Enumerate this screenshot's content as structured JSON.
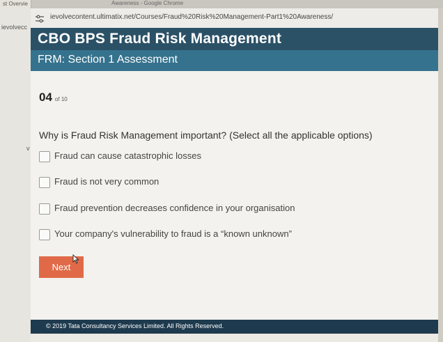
{
  "background": {
    "tab_text": "st Overvie",
    "window_title": "Awareness - Google Chrome",
    "url_fragment": "ievolvecc",
    "stray_char": "v"
  },
  "browser": {
    "url": "ievolvecontent.ultimatix.net/Courses/Fraud%20Risk%20Management-Part1%20Awareness/",
    "site_icon": "site-settings-icon"
  },
  "header": {
    "title": "CBO BPS Fraud Risk Management",
    "subtitle": "FRM: Section 1 Assessment",
    "color_primary": "#2b5166",
    "color_secondary": "#35728d"
  },
  "quiz": {
    "current": "04",
    "total_label": "of 10",
    "question": "Why is Fraud Risk Management important? (Select all the applicable options)",
    "options": [
      {
        "label": "Fraud can cause catastrophic losses",
        "checked": false
      },
      {
        "label": "Fraud is not very common",
        "checked": false
      },
      {
        "label": "Fraud prevention decreases confidence in your organisation",
        "checked": false
      },
      {
        "label": "Your company's vulnerability to fraud is a “known unknown”",
        "checked": false
      }
    ],
    "next_label": "Next",
    "next_color": "#e06a48"
  },
  "footer": {
    "text": "© 2019 Tata Consultancy Services Limited. All Rights Reserved."
  }
}
